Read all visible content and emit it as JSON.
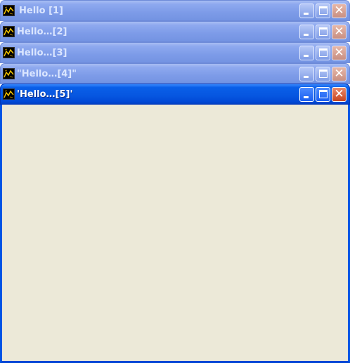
{
  "windows": [
    {
      "title": "Hello [1]",
      "state": "inactive"
    },
    {
      "title": "Hello…[2]",
      "state": "inactive"
    },
    {
      "title": "Hello…[3]",
      "state": "inactive"
    },
    {
      "title": "\"Hello…[4]\"",
      "state": "inactive"
    },
    {
      "title": "'Hello…[5]'",
      "state": "active"
    }
  ],
  "icons": {
    "app": "app-icon",
    "minimize": "minimize-icon",
    "maximize": "maximize-icon",
    "close": "close-icon"
  },
  "colors": {
    "active_titlebar": "#0656e0",
    "inactive_titlebar": "#7d9be8",
    "client_background": "#ece9d8",
    "close_button": "#c7441f"
  }
}
